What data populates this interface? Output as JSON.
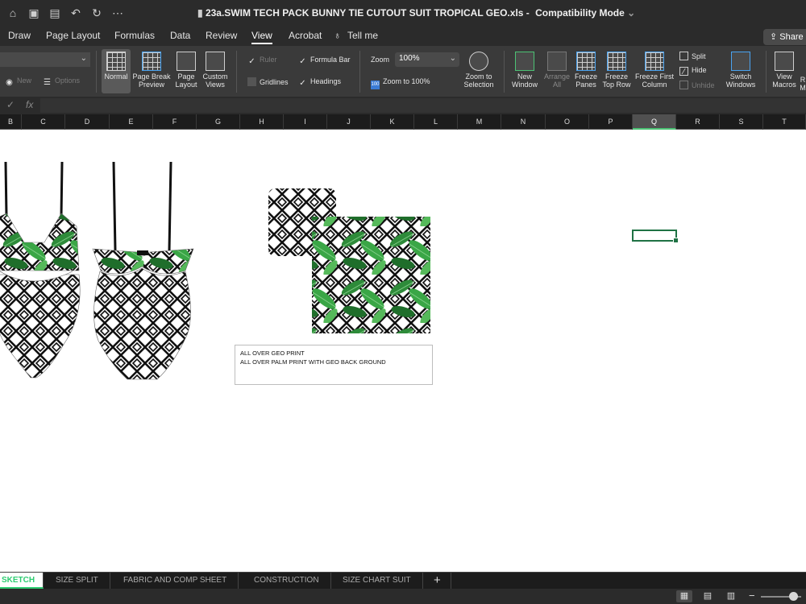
{
  "window": {
    "title": "23a.SWIM TECH PACK BUNNY TIE CUTOUT SUIT TROPICAL GEO.xls",
    "title_sep": "-",
    "mode": "Compatibility Mode"
  },
  "menu": {
    "items": [
      "Draw",
      "Page Layout",
      "Formulas",
      "Data",
      "Review",
      "View",
      "Acrobat",
      "Tell me"
    ],
    "active": "View",
    "share_label": "Share"
  },
  "ribbon": {
    "new_label": "New",
    "options_label": "Options",
    "normal": "Normal",
    "page_break_1": "Page Break",
    "page_break_2": "Preview",
    "page_layout_1": "Page",
    "page_layout_2": "Layout",
    "custom_views_1": "Custom",
    "custom_views_2": "Views",
    "ruler": "Ruler",
    "formula_bar": "Formula Bar",
    "gridlines": "Gridlines",
    "headings": "Headings",
    "zoom_label": "Zoom",
    "zoom_value": "100%",
    "zoom_100": "Zoom to 100%",
    "zoom_sel_1": "Zoom to",
    "zoom_sel_2": "Selection",
    "new_window_1": "New",
    "new_window_2": "Window",
    "arrange_1": "Arrange",
    "arrange_2": "All",
    "freeze_panes_1": "Freeze",
    "freeze_panes_2": "Panes",
    "freeze_top_1": "Freeze",
    "freeze_top_2": "Top Row",
    "freeze_first_1": "Freeze First",
    "freeze_first_2": "Column",
    "split": "Split",
    "hide": "Hide",
    "unhide": "Unhide",
    "switch_1": "Switch",
    "switch_2": "Windows",
    "macros_1": "View",
    "macros_2": "Macros",
    "record_1": "R",
    "record_2": "M"
  },
  "formula": {
    "check": "✓",
    "fx": "fx"
  },
  "columns": [
    "B",
    "C",
    "D",
    "E",
    "F",
    "G",
    "H",
    "I",
    "J",
    "K",
    "L",
    "M",
    "N",
    "O",
    "P",
    "Q",
    "R",
    "S",
    "T"
  ],
  "active_column": "Q",
  "textbox": {
    "line1": "ALL OVER GEO PRINT",
    "line2": "ALL OVER PALM PRINT WITH GEO BACK GROUND"
  },
  "sheets": [
    "SKETCH",
    "SIZE SPLIT",
    "FABRIC AND COMP SHEET",
    "CONSTRUCTION",
    "SIZE CHART SUIT"
  ],
  "active_sheet": "SKETCH",
  "add_sheet": "+",
  "colors": {
    "accent": "#2ecc71",
    "selection": "#1f7244"
  }
}
